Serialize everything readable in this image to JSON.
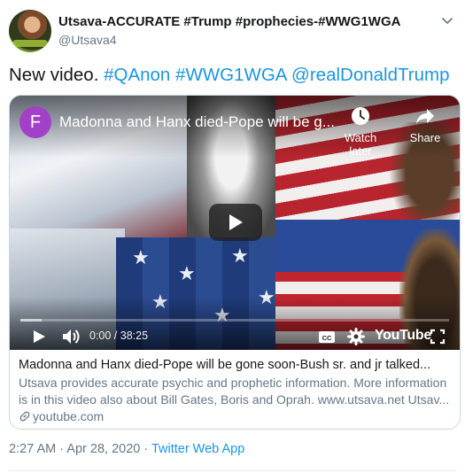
{
  "user": {
    "display_name": "Utsava-ACCURATE #Trump #prophecies-#WWG1WGA",
    "handle": "@Utsava4"
  },
  "tweet": {
    "text_plain": "New video. ",
    "hashtag1": "#QAnon",
    "hashtag2": "#WWG1WGA",
    "mention": "@realDonaldTrump"
  },
  "video": {
    "channel_initial": "F",
    "title": "Madonna and Hanx died-Pope will be g...",
    "watch_later_label": "Watch later",
    "share_label": "Share",
    "time": "0:00 / 38:25",
    "brand": "YouTube",
    "buffered_fraction": 0.05
  },
  "card": {
    "title": "Madonna and Hanx died-Pope will be gone soon-Bush sr. and jr talked...",
    "description": "Utsava provides accurate psychic and prophetic information. More information is in this video also about Bill Gates, Boris and Oprah. www.utsava.net Utsav...",
    "domain": "youtube.com"
  },
  "meta": {
    "timestamp": "2:27 AM · Apr 28, 2020",
    "separator": " · ",
    "source": "Twitter Web App"
  },
  "colors": {
    "link": "#1b95e0",
    "channel_avatar": "#a240c8"
  }
}
